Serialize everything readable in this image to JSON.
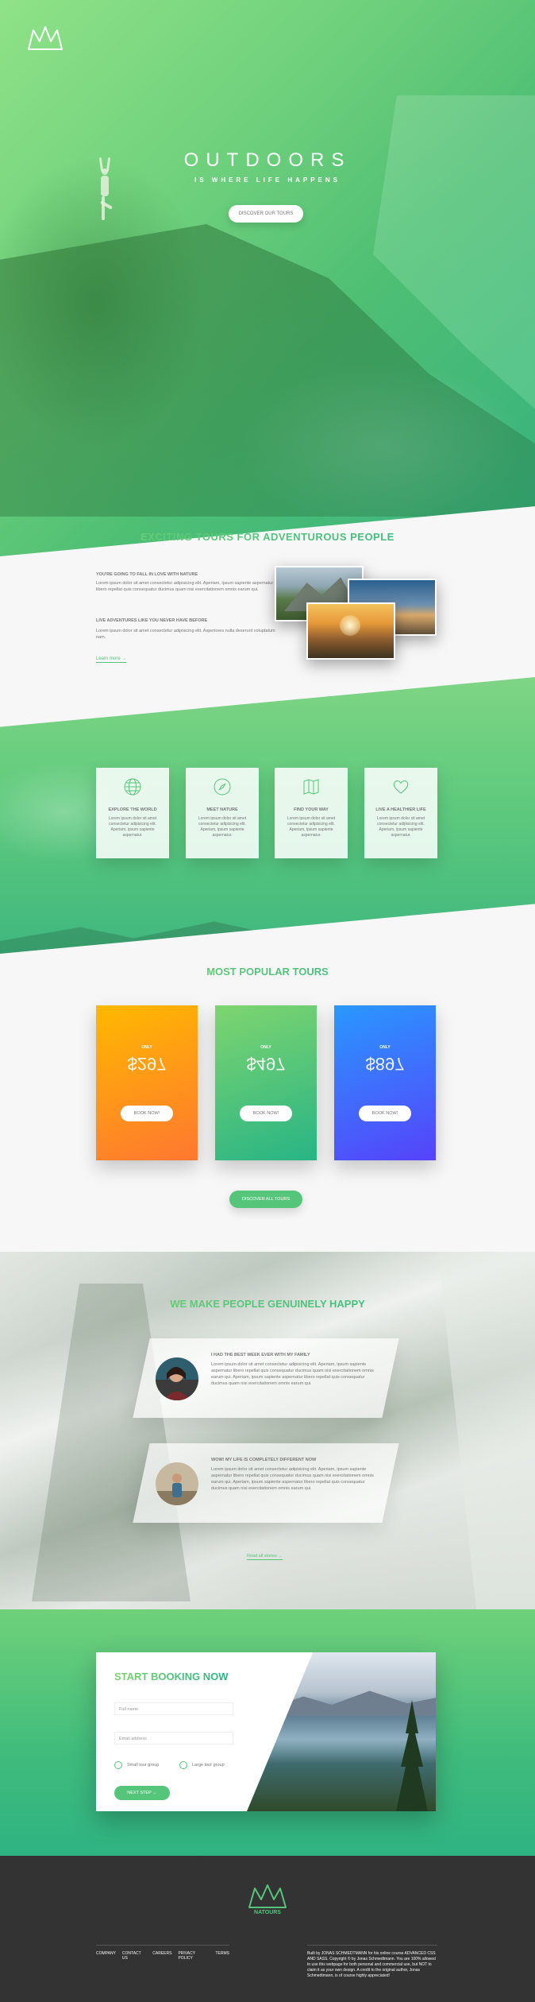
{
  "hero": {
    "title": "OUTDOORS",
    "subtitle": "IS WHERE LIFE HAPPENS",
    "cta": "DISCOVER OUR TOURS"
  },
  "about": {
    "title": "EXCITING TOURS FOR ADVENTUROUS PEOPLE",
    "heading1": "YOU'RE GOING TO FALL IN LOVE WITH NATURE",
    "text1": "Lorem ipsum dolor sit amet consectetur adipisicing elit. Aperiam, ipsum sapiente aspernatur libero repellat quis consequatur ducimus quam nisi exercitationem omnis earum qui.",
    "heading2": "LIVE ADVENTURES LIKE YOU NEVER HAVE BEFORE",
    "text2": "Lorem ipsum dolor sit amet consectetur adipisicing elit. Asperiores nulla deserunt voluptatum nam.",
    "link": "Learn more →"
  },
  "features": [
    {
      "icon": "globe-icon",
      "title": "EXPLORE THE WORLD",
      "text": "Lorem ipsum dolor sit amet consectetur adipisicing elit. Aperiam, ipsum sapiente aspernatur."
    },
    {
      "icon": "compass-icon",
      "title": "MEET NATURE",
      "text": "Lorem ipsum dolor sit amet consectetur adipisicing elit. Aperiam, ipsum sapiente aspernatur."
    },
    {
      "icon": "map-icon",
      "title": "FIND YOUR WAY",
      "text": "Lorem ipsum dolor sit amet consectetur adipisicing elit. Aperiam, ipsum sapiente aspernatur."
    },
    {
      "icon": "heart-icon",
      "title": "LIVE A HEALTHIER LIFE",
      "text": "Lorem ipsum dolor sit amet consectetur adipisicing elit. Aperiam, ipsum sapiente aspernatur."
    }
  ],
  "tours": {
    "title": "MOST POPULAR TOURS",
    "cards": [
      {
        "only": "ONLY",
        "price": "$297",
        "button": "BOOK NOW!"
      },
      {
        "only": "ONLY",
        "price": "$497",
        "button": "BOOK NOW!"
      },
      {
        "only": "ONLY",
        "price": "$897",
        "button": "BOOK NOW!"
      }
    ],
    "cta": "DISCOVER ALL TOURS"
  },
  "stories": {
    "title": "WE MAKE PEOPLE GENUINELY HAPPY",
    "items": [
      {
        "heading": "I HAD THE BEST WEEK EVER WITH MY FAMILY",
        "text": "Lorem ipsum dolor sit amet consectetur adipisicing elit. Aperiam, ipsum sapiente aspernatur libero repellat quis consequatur ducimus quam nisi exercitationem omnis earum qui. Aperiam, ipsum sapiente aspernatur libero repellat quis consequatur ducimus quam nisi exercitationem omnis earum qui."
      },
      {
        "heading": "WOW! MY LIFE IS COMPLETELY DIFFERENT NOW",
        "text": "Lorem ipsum dolor sit amet consectetur adipisicing elit. Aperiam, ipsum sapiente aspernatur libero repellat quis consequatur ducimus quam nisi exercitationem omnis earum qui. Aperiam, ipsum sapiente aspernatur libero repellat quis consequatur ducimus quam nisi exercitationem omnis earum qui."
      }
    ],
    "link": "Read all stories →"
  },
  "booking": {
    "title": "START BOOKING NOW",
    "name_placeholder": "Full name",
    "email_placeholder": "Email address",
    "radio1": "Small tour group",
    "radio2": "Large tour group",
    "button": "NEXT STEP →"
  },
  "footer": {
    "brand": "NATOURS",
    "nav": [
      "COMPANY",
      "CONTACT US",
      "CAREERS",
      "PRIVACY POLICY",
      "TERMS"
    ],
    "copyright": "Built by JONAS SCHMEDTMANN for his online course ADVANCED CSS AND SASS. Copyright © by Jonas Schmedtmann. You are 100% allowed to use this webpage for both personal and commercial use, but NOT to claim it as your own design. A credit to the original author, Jonas Schmedtmann, is of course highly appreciated!"
  },
  "colors": {
    "primary": "#55c57a",
    "primary_light": "#7ed56f",
    "primary_dark": "#28b485",
    "orange_light": "#ffb900",
    "orange_dark": "#ff7730",
    "blue_light": "#2998ff",
    "blue_dark": "#5643fa",
    "footer_bg": "#333333"
  }
}
